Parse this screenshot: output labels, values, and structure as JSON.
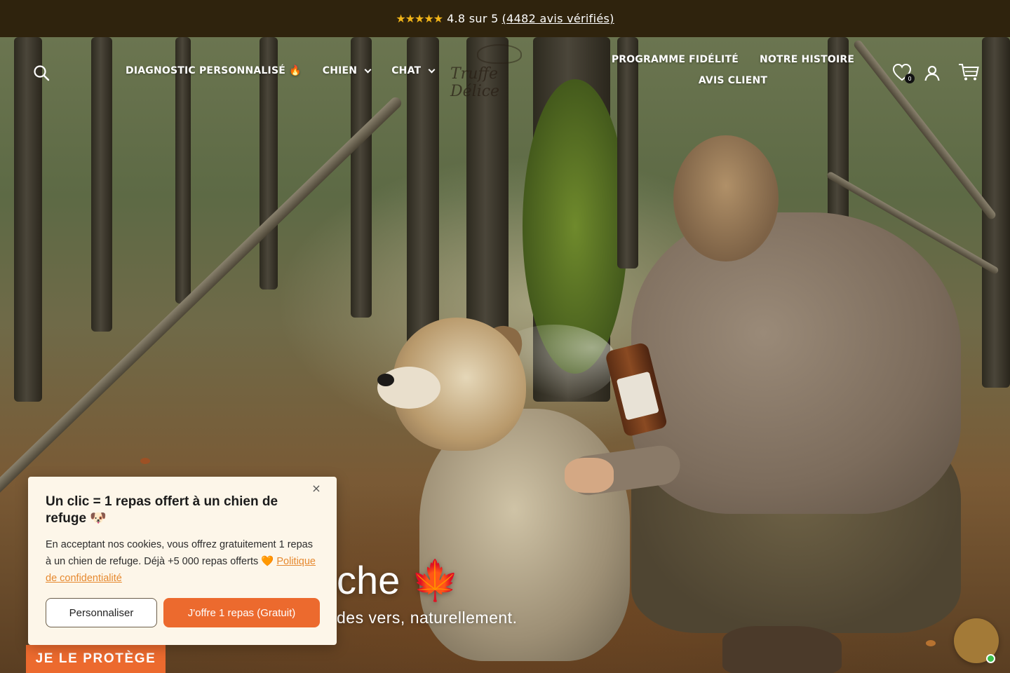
{
  "announcement": {
    "stars": "★★★★★",
    "rating_text": "4.8 sur 5",
    "reviews_link": "(4482 avis vérifiés)"
  },
  "header": {
    "logo_text": "Truffe Délice",
    "nav_left": [
      {
        "label": "DIAGNOSTIC PERSONNALISÉ 🔥"
      },
      {
        "label": "CHIEN"
      },
      {
        "label": "CHAT"
      }
    ],
    "nav_right": [
      {
        "label": "PROGRAMME FIDÉLITÉ"
      },
      {
        "label": "NOTRE HISTOIRE"
      },
      {
        "label": "AVIS CLIENT"
      }
    ],
    "wishlist_count": "0",
    "icons": [
      "search-icon",
      "heart-icon",
      "account-icon",
      "cart-icon"
    ]
  },
  "hero": {
    "title_visible": "che 🍁",
    "subtitle_visible": "des vers, naturellement.",
    "cta_label": "JE LE PROTÈGE"
  },
  "cookie_popup": {
    "title": "Un clic = 1 repas offert à un chien de refuge 🐶",
    "body": "En acceptant nos cookies, vous offrez gratuitement 1 repas à un chien de refuge. Déjà +5 000 repas offerts 🧡",
    "privacy_link": "Politique de confidentialité",
    "customize_label": "Personnaliser",
    "accept_label": "J'offre 1 repas (Gratuit)",
    "close_symbol": "×"
  },
  "colors": {
    "announcement_bg": "#2f230d",
    "accent_orange": "#ec6a2e",
    "star_yellow": "#f2b519",
    "popup_bg": "#fdf6e9",
    "chat_bubble": "#a37a37",
    "online_green": "#3bbf4c"
  }
}
